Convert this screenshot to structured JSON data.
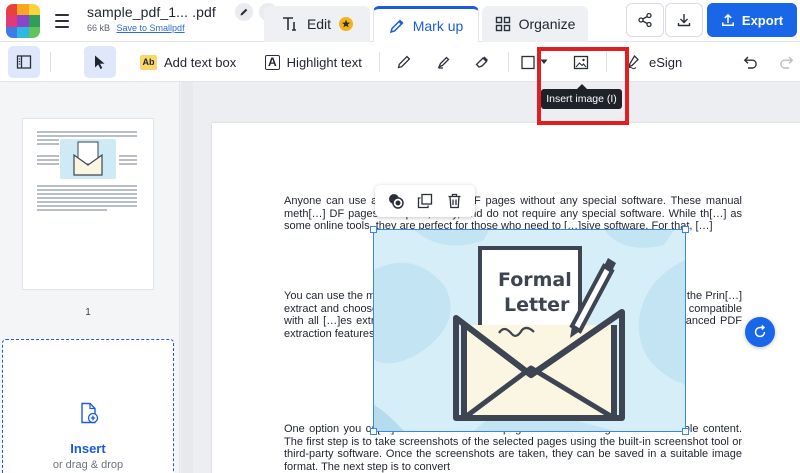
{
  "header": {
    "file_name": "sample_pdf_1... .pdf",
    "file_size": "66 kB",
    "save_link": "Save to Smallpdf",
    "tabs": [
      {
        "label": "Edit"
      },
      {
        "label": "Mark up"
      },
      {
        "label": "Organize"
      }
    ],
    "export_label": "Export"
  },
  "toolbar": {
    "ab_badge": "Ab",
    "add_text_box": "Add text box",
    "highlight_badge": "A",
    "highlight_text": "Highlight text",
    "esign": "eSign",
    "tooltip": "Insert image (I)"
  },
  "sidebar": {
    "page_number": "1",
    "insert_label": "Insert",
    "insert_sub": "or drag & drop"
  },
  "document": {
    "p1": "Anyone can use a t[…] to extract PDF pages without any special software. These manual meth[…] DF pages are quick, easy, and do not require any special software. While th[…] as some online tools, they are perfect for those who need to […]sive software. For that, […]",
    "p2": "You can use the m[…]document. To do this, open the P[…] Print option and select the Prin[…] extract and choose the option t[…] nother PDF document with onl[…] may not be compatible with all […]es extracting the PDF pages in[…]ents. As an alternative, there a[…]anced PDF extraction features[…]our needs.",
    "p3": "One option you ca[…] shots of the desired pages and converting them into usable content. The first step is to take screenshots of the selected pages using the built-in screenshot tool or third-party software. Once the screenshots are taken, they can be saved in a suitable image format. The next step is to convert",
    "image_text_line1": "Formal",
    "image_text_line2": "Letter"
  },
  "colors": {
    "accent": "#1a66e8",
    "highlight_box": "#e11e22",
    "tooltip_bg": "#1f2228",
    "envelope_stroke": "#3d4452",
    "envelope_fill": "#fbf6e1",
    "image_bg": "#d6eef8"
  }
}
